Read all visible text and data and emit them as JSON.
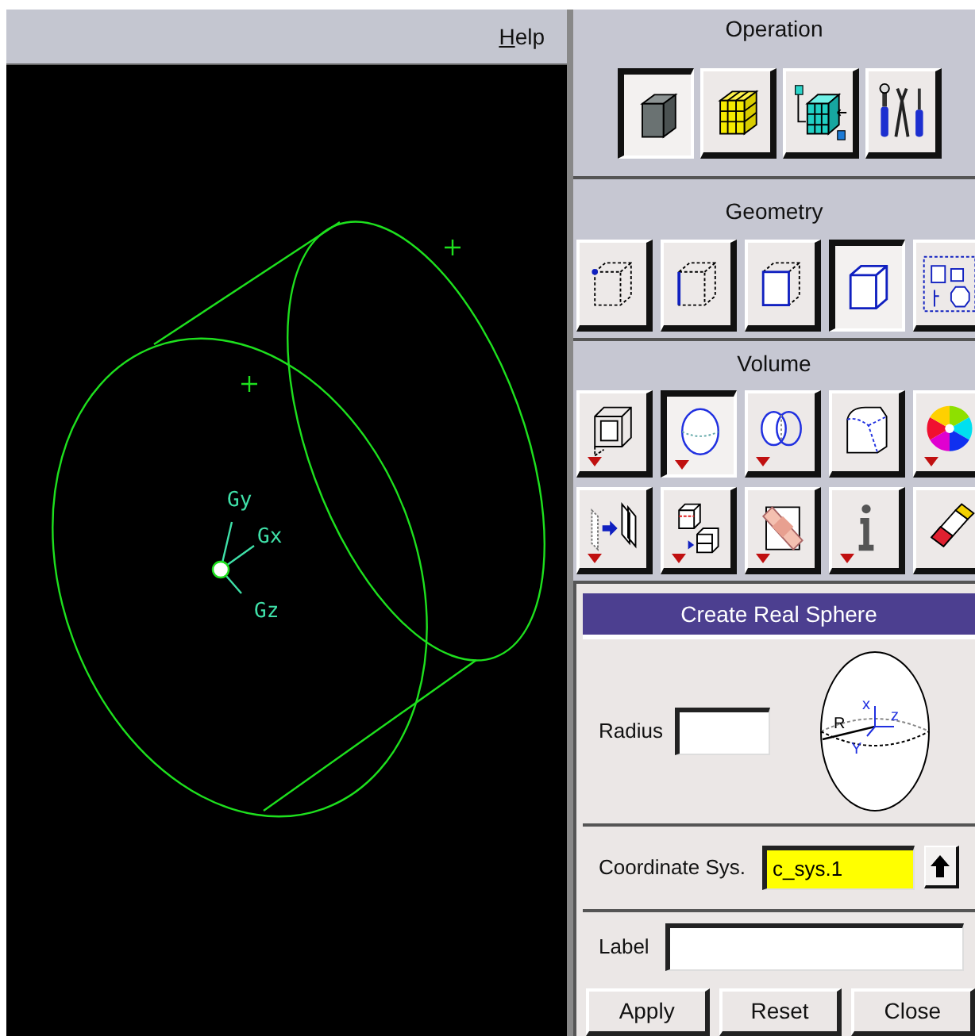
{
  "menu_bar": {
    "items": [
      {
        "label": "Help"
      }
    ]
  },
  "viewport": {
    "axis_labels": [
      "Gy",
      "Gx",
      "Gz"
    ]
  },
  "operation": {
    "title": "Operation",
    "buttons": [
      {
        "kind": "solid-cube",
        "selected": true
      },
      {
        "kind": "grid-cube",
        "selected": false
      },
      {
        "kind": "zone-cube",
        "selected": false
      },
      {
        "kind": "tools",
        "selected": false
      }
    ]
  },
  "geometry": {
    "title": "Geometry",
    "buttons": [
      {
        "kind": "vertex",
        "selected": false
      },
      {
        "kind": "edge",
        "selected": false
      },
      {
        "kind": "face",
        "selected": false
      },
      {
        "kind": "volume",
        "selected": true
      },
      {
        "kind": "group",
        "selected": false
      }
    ]
  },
  "volume": {
    "title": "Volume",
    "buttons": [
      {
        "kind": "box",
        "selected": false,
        "has_menu": true
      },
      {
        "kind": "sphere",
        "selected": true,
        "has_menu": true
      },
      {
        "kind": "boolean",
        "selected": false,
        "has_menu": true
      },
      {
        "kind": "blend",
        "selected": false,
        "has_menu": false
      },
      {
        "kind": "color-wheel",
        "selected": false,
        "has_menu": true
      },
      {
        "kind": "move",
        "selected": false,
        "has_menu": true
      },
      {
        "kind": "split",
        "selected": false,
        "has_menu": true
      },
      {
        "kind": "bandage",
        "selected": false,
        "has_menu": true
      },
      {
        "kind": "info",
        "selected": false,
        "has_menu": true
      },
      {
        "kind": "eraser",
        "selected": false,
        "has_menu": false
      }
    ]
  },
  "form": {
    "title": "Create Real Sphere",
    "radius": {
      "label": "Radius"
    },
    "diagram_labels": [
      "R",
      "x",
      "z",
      "Y"
    ],
    "coordinate_sys": {
      "label": "Coordinate Sys.",
      "value": "c_sys.1"
    },
    "label_field": {
      "label": "Label"
    },
    "buttons": [
      "Apply",
      "Reset",
      "Close"
    ]
  }
}
